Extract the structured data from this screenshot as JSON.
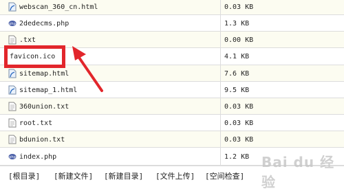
{
  "files": [
    {
      "name": "webscan_360_cn.html",
      "size": "0.03 KB",
      "icon": "html-file-icon"
    },
    {
      "name": "2dedecms.php",
      "size": "1.3 KB",
      "icon": "php-file-icon"
    },
    {
      "name": ".txt",
      "size": "0.00 KB",
      "icon": "text-file-icon"
    },
    {
      "name": "favicon.ico",
      "size": "4.1 KB",
      "icon": "ico-file-icon"
    },
    {
      "name": "sitemap.html",
      "size": "7.6 KB",
      "icon": "html-file-icon"
    },
    {
      "name": "sitemap_1.html",
      "size": "9.5 KB",
      "icon": "html-file-icon"
    },
    {
      "name": "360union.txt",
      "size": "0.03 KB",
      "icon": "text-file-icon"
    },
    {
      "name": "root.txt",
      "size": "0.03 KB",
      "icon": "text-file-icon"
    },
    {
      "name": "bdunion.txt",
      "size": "0.03 KB",
      "icon": "text-file-icon"
    },
    {
      "name": "index.php",
      "size": "1.2 KB",
      "icon": "php-file-icon"
    }
  ],
  "footer": {
    "root_dir": "[根目录]",
    "new_file": "[新建文件]",
    "new_dir": "[新建目录]",
    "upload": "[文件上传]",
    "space_check": "[空间检查]"
  },
  "annotation": {
    "highlight_color": "#e2262b"
  },
  "watermark": {
    "text": "Bai du 经验"
  }
}
